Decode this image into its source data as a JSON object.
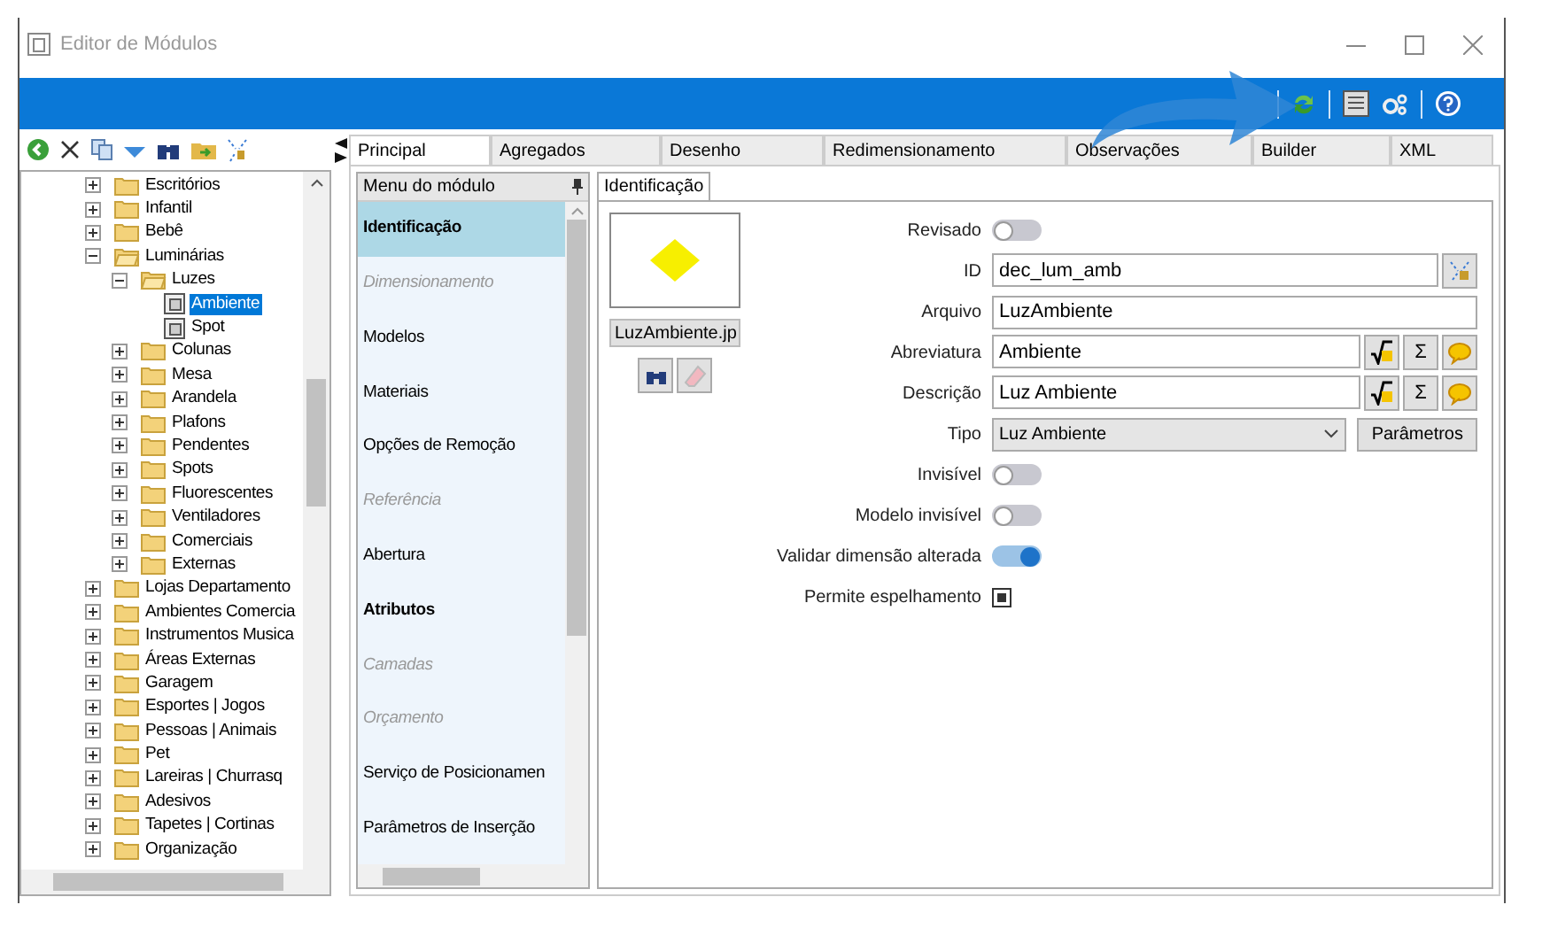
{
  "window": {
    "title": "Editor de Módulos"
  },
  "tree": [
    {
      "label": "Escritórios",
      "kind": "folder",
      "expanded": false,
      "selected": false
    },
    {
      "label": "Infantil",
      "kind": "folder",
      "expanded": false,
      "selected": false
    },
    {
      "label": "Bebê",
      "kind": "folder",
      "expanded": false,
      "selected": false
    },
    {
      "label": "Luminárias",
      "kind": "folder",
      "expanded": true,
      "selected": false,
      "children": [
        {
          "label": "Luzes",
          "kind": "folder",
          "expanded": true,
          "selected": false,
          "children": [
            {
              "label": "Ambiente",
              "kind": "module",
              "selected": true
            },
            {
              "label": "Spot",
              "kind": "module",
              "selected": false
            }
          ]
        },
        {
          "label": "Colunas",
          "kind": "folder",
          "expanded": false,
          "selected": false
        },
        {
          "label": "Mesa",
          "kind": "folder",
          "expanded": false,
          "selected": false
        },
        {
          "label": "Arandela",
          "kind": "folder",
          "expanded": false,
          "selected": false
        },
        {
          "label": "Plafons",
          "kind": "folder",
          "expanded": false,
          "selected": false
        },
        {
          "label": "Pendentes",
          "kind": "folder",
          "expanded": false,
          "selected": false
        },
        {
          "label": "Spots",
          "kind": "folder",
          "expanded": false,
          "selected": false
        },
        {
          "label": "Fluorescentes",
          "kind": "folder",
          "expanded": false,
          "selected": false
        },
        {
          "label": "Ventiladores",
          "kind": "folder",
          "expanded": false,
          "selected": false
        },
        {
          "label": "Comerciais",
          "kind": "folder",
          "expanded": false,
          "selected": false
        },
        {
          "label": "Externas",
          "kind": "folder",
          "expanded": false,
          "selected": false
        }
      ]
    },
    {
      "label": "Lojas Departamento",
      "kind": "folder",
      "expanded": false,
      "selected": false
    },
    {
      "label": "Ambientes Comercia",
      "kind": "folder",
      "expanded": false,
      "selected": false
    },
    {
      "label": "Instrumentos Musica",
      "kind": "folder",
      "expanded": false,
      "selected": false
    },
    {
      "label": "Áreas Externas",
      "kind": "folder",
      "expanded": false,
      "selected": false
    },
    {
      "label": "Garagem",
      "kind": "folder",
      "expanded": false,
      "selected": false
    },
    {
      "label": "Esportes | Jogos",
      "kind": "folder",
      "expanded": false,
      "selected": false
    },
    {
      "label": "Pessoas | Animais",
      "kind": "folder",
      "expanded": false,
      "selected": false
    },
    {
      "label": "Pet",
      "kind": "folder",
      "expanded": false,
      "selected": false
    },
    {
      "label": "Lareiras | Churrasq",
      "kind": "folder",
      "expanded": false,
      "selected": false
    },
    {
      "label": "Adesivos",
      "kind": "folder",
      "expanded": false,
      "selected": false
    },
    {
      "label": "Tapetes | Cortinas",
      "kind": "folder",
      "expanded": false,
      "selected": false
    },
    {
      "label": "Organização",
      "kind": "folder",
      "expanded": false,
      "selected": false
    }
  ],
  "tabs": [
    {
      "label": "Principal",
      "selected": true
    },
    {
      "label": "Agregados",
      "selected": false
    },
    {
      "label": "Desenho",
      "selected": false
    },
    {
      "label": "Redimensionamento",
      "selected": false
    },
    {
      "label": "Observações",
      "selected": false
    },
    {
      "label": "Builder",
      "selected": false
    },
    {
      "label": "XML",
      "selected": false
    }
  ],
  "module_menu": {
    "title": "Menu do módulo",
    "items": [
      {
        "label": "Identificação",
        "selected": true,
        "disabled": false,
        "bold": true
      },
      {
        "label": "Dimensionamento",
        "selected": false,
        "disabled": true,
        "bold": false
      },
      {
        "label": "Modelos",
        "selected": false,
        "disabled": false,
        "bold": false
      },
      {
        "label": "Materiais",
        "selected": false,
        "disabled": false,
        "bold": false
      },
      {
        "label": "Opções de Remoção",
        "selected": false,
        "disabled": false,
        "bold": false
      },
      {
        "label": "Referência",
        "selected": false,
        "disabled": true,
        "bold": false
      },
      {
        "label": "Abertura",
        "selected": false,
        "disabled": false,
        "bold": false
      },
      {
        "label": "Atributos",
        "selected": false,
        "disabled": false,
        "bold": true
      },
      {
        "label": "Camadas",
        "selected": false,
        "disabled": true,
        "bold": false
      },
      {
        "label": "Orçamento",
        "selected": false,
        "disabled": true,
        "bold": false
      },
      {
        "label": "Serviço de Posicionamen",
        "selected": false,
        "disabled": false,
        "bold": false
      },
      {
        "label": "Parâmetros de Inserção",
        "selected": false,
        "disabled": false,
        "bold": false
      }
    ]
  },
  "form": {
    "tab": "Identificação",
    "image_file": "LuzAmbiente.jp",
    "rows": [
      {
        "kind": "toggle",
        "label": "Revisado",
        "on": false
      },
      {
        "kind": "text_picker",
        "label": "ID",
        "value": "dec_lum_amb"
      },
      {
        "kind": "text",
        "label": "Arquivo",
        "value": "LuzAmbiente"
      },
      {
        "kind": "text_formula",
        "label": "Abreviatura",
        "value": "Ambiente",
        "sigma": "Σ"
      },
      {
        "kind": "text_formula",
        "label": "Descrição",
        "value": "Luz Ambiente",
        "sigma": "Σ"
      },
      {
        "kind": "select",
        "label": "Tipo",
        "value": "Luz Ambiente",
        "button": "Parâmetros"
      },
      {
        "kind": "toggle",
        "label": "Invisível",
        "on": false
      },
      {
        "kind": "toggle",
        "label": "Modelo invisível",
        "on": false
      },
      {
        "kind": "toggle",
        "label": "Validar dimensão alterada",
        "on": true
      },
      {
        "kind": "checkbox",
        "label": "Permite espelhamento",
        "checked": true
      }
    ]
  }
}
